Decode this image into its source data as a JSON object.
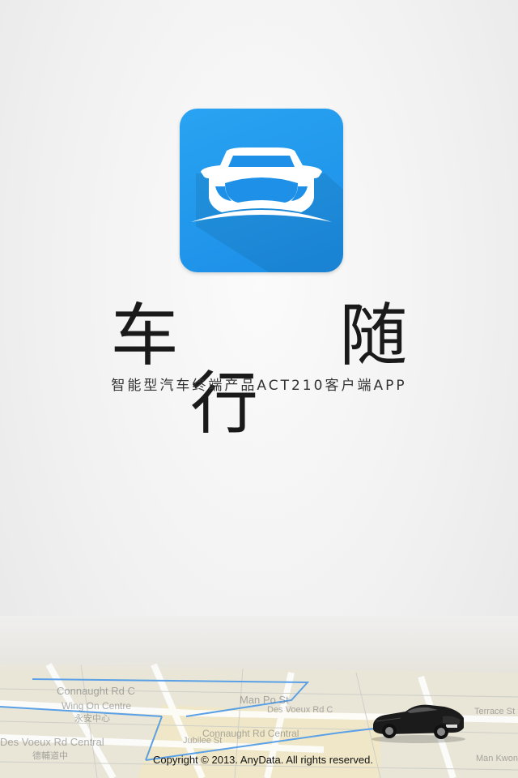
{
  "splash": {
    "app_name": "车 随 行",
    "tagline": "智能型汽车终端产品ACT210客户端APP",
    "copyright": "Copyright © 2013. AnyData. All rights reserved."
  },
  "icon": {
    "name": "car-front-icon",
    "background_color": "#1E90E8",
    "foreground_color": "#FFFFFF"
  },
  "map": {
    "street_labels": [
      "Connaught Rd C",
      "Wing On Centre",
      "永安中心",
      "Man Po St",
      "Des Voeux Rd Central",
      "德輔道中",
      "Connaught Rd Central",
      "Des Voeux Rd C",
      "Jubilee St",
      "Terrace St",
      "Man Kwon"
    ],
    "route_color": "#5aa0e6"
  }
}
